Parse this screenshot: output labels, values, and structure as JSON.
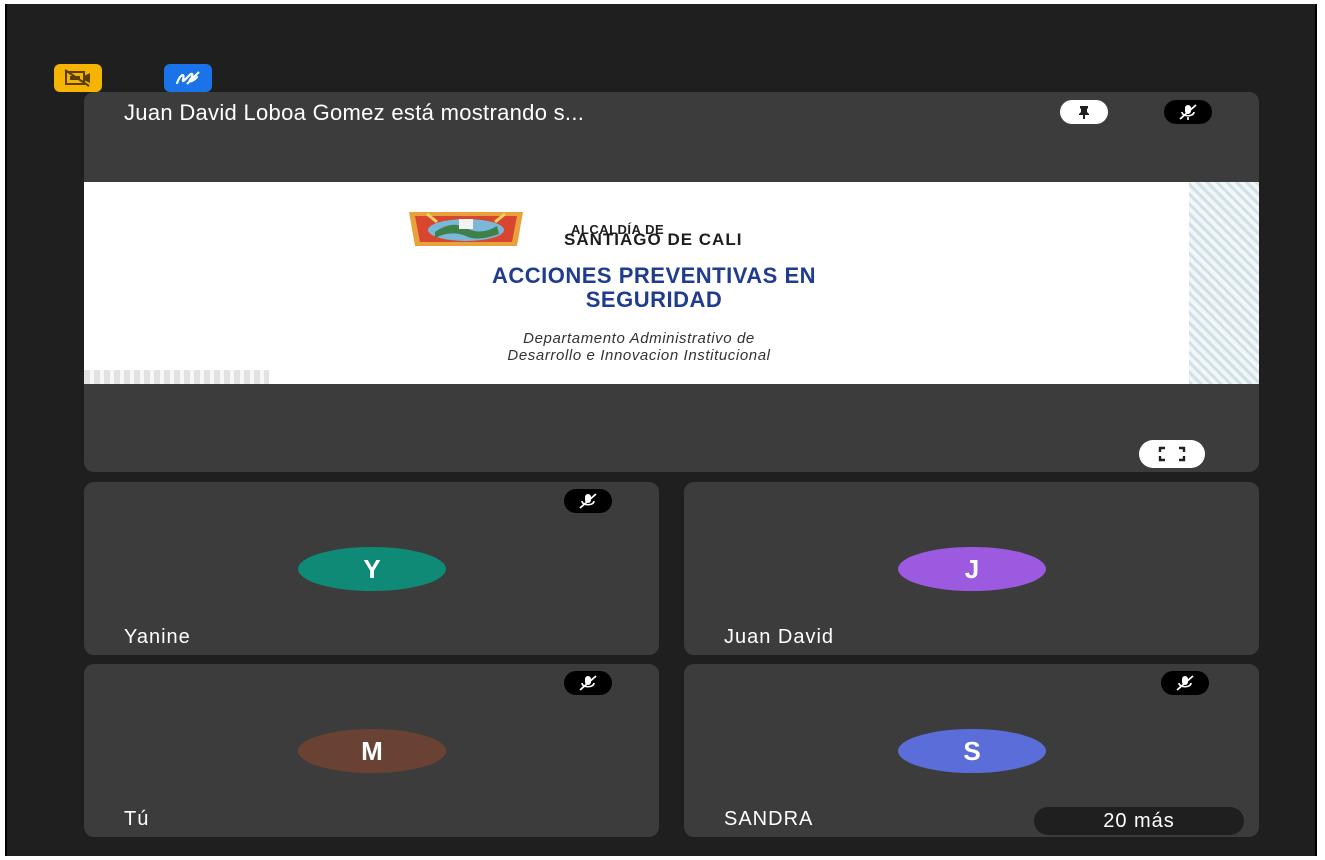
{
  "toolbar": {
    "camera_off_icon": "camera-off-icon",
    "annotate_icon": "pen-icon",
    "yellow": "#f4b400",
    "blue": "#1a73e8"
  },
  "main": {
    "presenter_label": "Juan David Loboa Gomez está mostrando s...",
    "slide": {
      "org_line1": "ALCALDÍA DE",
      "org_line2": "SANTIAGO DE CALI",
      "title_line1": "ACCIONES PREVENTIVAS EN",
      "title_line2": "SEGURIDAD",
      "subtitle_line1": "Departamento Administrativo de",
      "subtitle_line2": "Desarrollo e Innovacion Institucional"
    }
  },
  "participants": [
    {
      "initial": "Y",
      "name": "Yanine",
      "color": "#0f8a76",
      "muted": true
    },
    {
      "initial": "J",
      "name": "Juan David",
      "color": "#9c5ae0",
      "muted": false
    },
    {
      "initial": "M",
      "name": "Tú",
      "color": "#6a4233",
      "muted": true
    },
    {
      "initial": "S",
      "name": "SANDRA",
      "color": "#5b6dd8",
      "muted": true
    }
  ],
  "more_label": "20 más"
}
